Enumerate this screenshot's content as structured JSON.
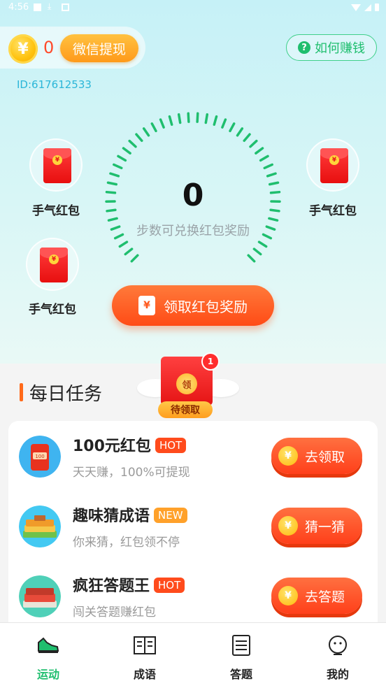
{
  "status_bar": {
    "time": "4:56"
  },
  "header": {
    "coin_symbol": "¥",
    "coin_count": "0",
    "withdraw_label": "微信提现",
    "how_to_earn_label": "如何赚钱",
    "help_icon_glyph": "?",
    "user_id": "ID:617612533"
  },
  "envelopes": [
    {
      "label": "手气红包",
      "icon": "red-envelope-icon"
    },
    {
      "label": "手气红包",
      "icon": "red-envelope-icon"
    },
    {
      "label": "手气红包",
      "icon": "red-envelope-icon"
    }
  ],
  "envelope_coin": "¥",
  "step_gauge": {
    "value": "0",
    "description": "步数可兑换红包奖励",
    "progress": 0
  },
  "claim_button": {
    "label": "领取红包奖励",
    "icon_glyph": "¥"
  },
  "daily_tasks": {
    "title": "每日任务",
    "pending": {
      "badge": "1",
      "coin_text": "领",
      "label": "待领取"
    },
    "items": [
      {
        "title": "100元红包",
        "tag": "HOT",
        "subtitle": "天天赚，100%可提现",
        "button": "去领取",
        "icon": "red-packet-100-icon"
      },
      {
        "title": "趣味猜成语",
        "tag": "NEW",
        "subtitle": "你来猜，红包领不停",
        "button": "猜一猜",
        "icon": "idiom-books-icon"
      },
      {
        "title": "疯狂答题王",
        "tag": "HOT",
        "subtitle": "闯关答题赚红包",
        "button": "去答题",
        "icon": "quiz-books-icon"
      }
    ],
    "button_coin": "¥"
  },
  "bottom_nav": {
    "items": [
      {
        "label": "运动",
        "icon": "sneaker-icon",
        "active": true
      },
      {
        "label": "成语",
        "icon": "open-book-icon",
        "active": false
      },
      {
        "label": "答题",
        "icon": "answer-sheet-icon",
        "active": false
      },
      {
        "label": "我的",
        "icon": "profile-face-icon",
        "active": false
      }
    ]
  },
  "colors": {
    "accent_green": "#1fbe6e",
    "accent_orange": "#ff5a1f",
    "coin_count_red": "#ff4a2a",
    "id_blue": "#2bb6d8"
  }
}
